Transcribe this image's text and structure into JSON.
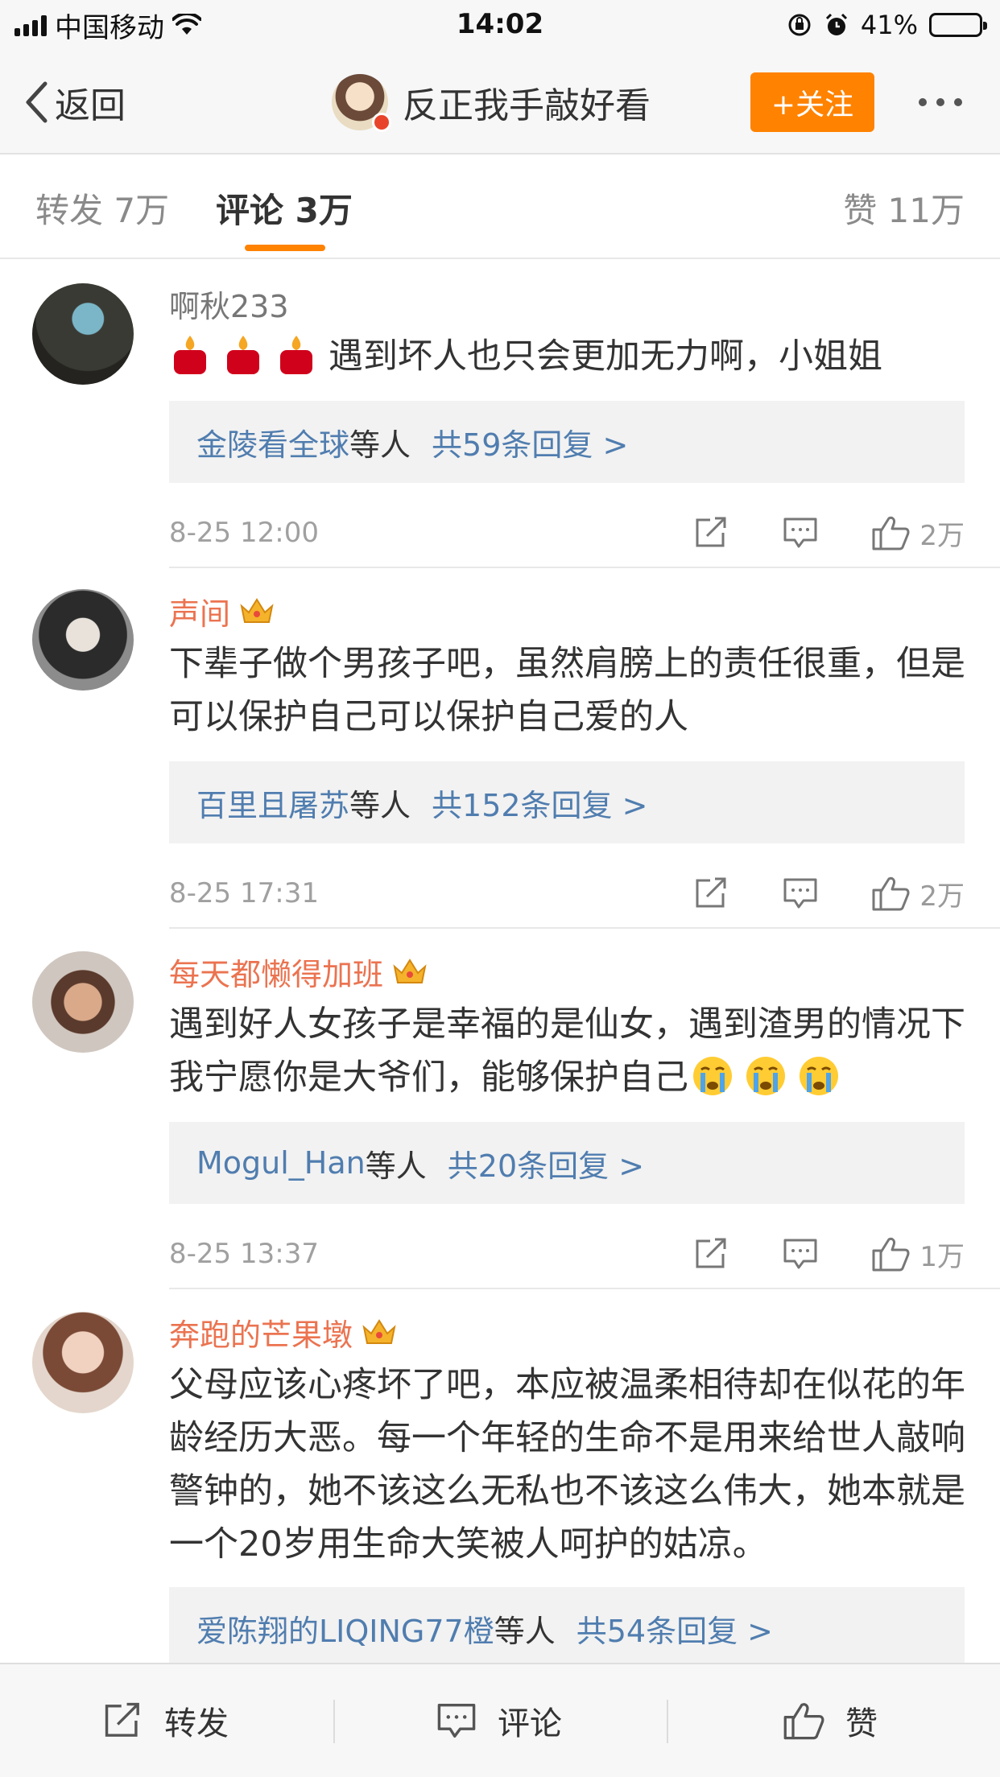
{
  "status_bar": {
    "carrier": "中国移动",
    "time": "14:02",
    "battery": "41%",
    "battery_level": 0.41
  },
  "nav": {
    "back_label": "返回",
    "title": "反正我手敲好看",
    "follow_label": "+关注"
  },
  "tabs": [
    {
      "label": "转发 7万"
    },
    {
      "label": "评论 3万"
    },
    {
      "label": "赞 11万"
    }
  ],
  "comments": [
    {
      "username": "啊秋233",
      "vip": false,
      "text": "遇到坏人也只会更加无力啊，小姐姐",
      "reply_users": "金陵看全球",
      "reply_etc": "等人",
      "reply_count": "共59条回复 >",
      "time": "8-25 12:00",
      "likes": "2万"
    },
    {
      "username": "声间",
      "vip": true,
      "text": "下辈子做个男孩子吧，虽然肩膀上的责任很重，但是可以保护自己可以保护自己爱的人",
      "reply_users": "百里且屠苏",
      "reply_etc": "等人",
      "reply_count": "共152条回复 >",
      "time": "8-25 17:31",
      "likes": "2万"
    },
    {
      "username": "每天都懒得加班",
      "vip": true,
      "text": "遇到好人女孩子是幸福的是仙女，遇到渣男的情况下我宁愿你是大爷们，能够保护自己",
      "reply_users": "Mogul_Han",
      "reply_etc": "等人",
      "reply_count": "共20条回复 >",
      "time": "8-25 13:37",
      "likes": "1万"
    },
    {
      "username": "奔跑的芒果墩",
      "vip": true,
      "text": "父母应该心疼坏了吧，本应被温柔相待却在似花的年龄经历大恶。每一个年轻的生命不是用来给世人敲响警钟的，她不该这么无私也不该这么伟大，她本就是一个20岁用生命大笑被人呵护的姑凉。",
      "reply_users": "爱陈翔的LIQING77橙",
      "reply_etc": "等人",
      "reply_count": "共54条回复 >"
    }
  ],
  "bottom_bar": {
    "repost": "转发",
    "comment": "评论",
    "like": "赞"
  },
  "colors": {
    "accent": "#ff8200",
    "link": "#507daf",
    "vip_name": "#eb7350"
  }
}
